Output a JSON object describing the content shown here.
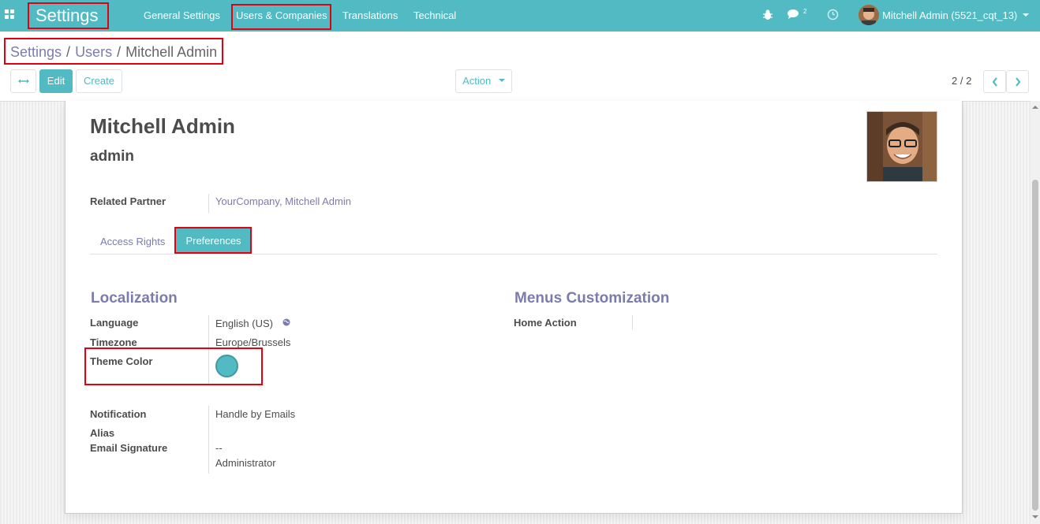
{
  "topbar": {
    "app_title": "Settings",
    "menu": [
      "General Settings",
      "Users & Companies",
      "Translations",
      "Technical"
    ],
    "chat_count": "2",
    "user_label": "Mitchell Admin (5521_cqt_13)"
  },
  "breadcrumb": {
    "items": [
      "Settings",
      "Users"
    ],
    "current": "Mitchell Admin",
    "separator": "/"
  },
  "control_panel": {
    "edit_label": "Edit",
    "create_label": "Create",
    "action_label": "Action",
    "pager": "2 / 2"
  },
  "record": {
    "name": "Mitchell Admin",
    "login": "admin",
    "related_partner_label": "Related Partner",
    "related_partner_value": "YourCompany, Mitchell Admin"
  },
  "tabs": {
    "access_rights": "Access Rights",
    "preferences": "Preferences"
  },
  "localization": {
    "title": "Localization",
    "language_label": "Language",
    "language_value": "English (US)",
    "timezone_label": "Timezone",
    "timezone_value": "Europe/Brussels",
    "theme_color_label": "Theme Color",
    "theme_color": "#51bac3"
  },
  "menus": {
    "title": "Menus Customization",
    "home_action_label": "Home Action",
    "home_action_value": ""
  },
  "messaging": {
    "notification_label": "Notification",
    "notification_value": "Handle by Emails",
    "alias_label": "Alias",
    "signature_label": "Email Signature",
    "signature_lines": [
      "--",
      "Administrator"
    ]
  },
  "colors": {
    "brand": "#51bac3",
    "link": "#7c7bad",
    "highlight": "#e3000f"
  }
}
